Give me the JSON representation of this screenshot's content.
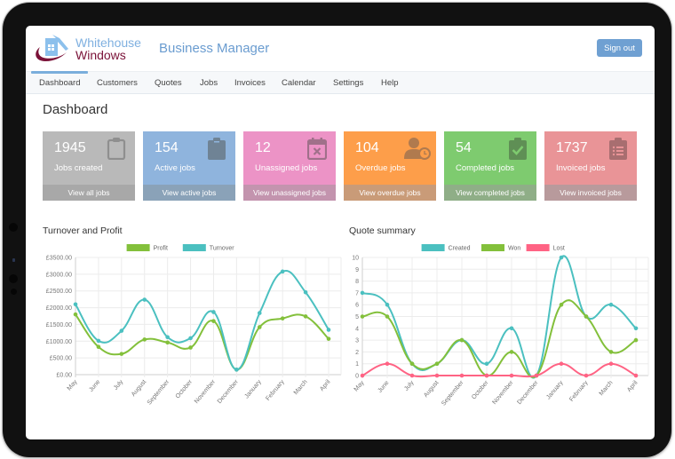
{
  "header": {
    "logo_line1": "Whitehouse",
    "logo_line2": "Windows",
    "app_title": "Business Manager",
    "sign_out_label": "Sign out"
  },
  "nav": {
    "items": [
      {
        "label": "Dashboard",
        "active": true
      },
      {
        "label": "Customers"
      },
      {
        "label": "Quotes"
      },
      {
        "label": "Jobs"
      },
      {
        "label": "Invoices"
      },
      {
        "label": "Calendar"
      },
      {
        "label": "Settings"
      },
      {
        "label": "Help"
      }
    ]
  },
  "page": {
    "title": "Dashboard"
  },
  "cards": [
    {
      "value": "1945",
      "label": "Jobs created",
      "link": "View all jobs",
      "icon": "clipboard-icon",
      "color": "#b9b9b9",
      "footer_color": "#a8a8a8",
      "icon_color": "#8f8f8f"
    },
    {
      "value": "154",
      "label": "Active jobs",
      "link": "View active jobs",
      "icon": "clipboard-filled-icon",
      "color": "#8fb4dd",
      "footer_color": "#8aa2b8",
      "icon_color": "#6f8395"
    },
    {
      "value": "12",
      "label": "Unassigned jobs",
      "link": "View unassigned jobs",
      "icon": "calendar-x-icon",
      "color": "#ec93c6",
      "footer_color": "#c394ae",
      "icon_color": "#a0708a"
    },
    {
      "value": "104",
      "label": "Overdue jobs",
      "link": "View overdue jobs",
      "icon": "user-clock-icon",
      "color": "#fd9e4a",
      "footer_color": "#c99b78",
      "icon_color": "#b07a4e"
    },
    {
      "value": "54",
      "label": "Completed jobs",
      "link": "View completed jobs",
      "icon": "clipboard-check-icon",
      "color": "#7ecb6f",
      "footer_color": "#8fae87",
      "icon_color": "#5f8f55"
    },
    {
      "value": "1737",
      "label": "Invoiced jobs",
      "link": "View invoiced jobs",
      "icon": "clipboard-list-icon",
      "color": "#e99497",
      "footer_color": "#b89a9c",
      "icon_color": "#a86e70"
    }
  ],
  "chart_data": [
    {
      "type": "line",
      "title": "Turnover and Profit",
      "categories": [
        "May",
        "June",
        "July",
        "August",
        "September",
        "October",
        "November",
        "December",
        "January",
        "February",
        "March",
        "April"
      ],
      "series": [
        {
          "name": "Profit",
          "color": "#83c03b",
          "values": [
            1800,
            830,
            620,
            1050,
            960,
            810,
            1600,
            150,
            1420,
            1680,
            1740,
            1070
          ]
        },
        {
          "name": "Turnover",
          "color": "#4bc0c0",
          "values": [
            2100,
            1010,
            1310,
            2240,
            1120,
            1090,
            1870,
            150,
            1840,
            3080,
            2460,
            1340
          ]
        }
      ],
      "ylim": [
        0,
        3500
      ],
      "yticks": [
        "£0.00",
        "£500.00",
        "£1000.00",
        "£1500.00",
        "£2000.00",
        "£2500.00",
        "£3000.00",
        "£3500.00"
      ],
      "legend": "top-center",
      "grid": true
    },
    {
      "type": "line",
      "title": "Quote summary",
      "categories": [
        "May",
        "June",
        "July",
        "August",
        "September",
        "October",
        "November",
        "December",
        "January",
        "February",
        "March",
        "April"
      ],
      "series": [
        {
          "name": "Created",
          "color": "#4bc0c0",
          "values": [
            7,
            6,
            1,
            1,
            3,
            1,
            4,
            0,
            10,
            5,
            6,
            4
          ]
        },
        {
          "name": "Won",
          "color": "#83c03b",
          "values": [
            5,
            5,
            1,
            1,
            3,
            0,
            2,
            0,
            6,
            5,
            2,
            3
          ]
        },
        {
          "name": "Lost",
          "color": "#ff6384",
          "values": [
            0,
            1,
            0,
            0,
            0,
            0,
            0,
            0,
            1,
            0,
            1,
            0
          ]
        }
      ],
      "ylim": [
        0,
        10
      ],
      "yticks": [
        "0",
        "1",
        "2",
        "3",
        "4",
        "5",
        "6",
        "7",
        "8",
        "9",
        "10"
      ],
      "legend": "top-center",
      "grid": true
    }
  ]
}
